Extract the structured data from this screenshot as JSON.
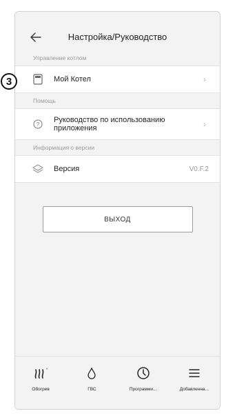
{
  "header": {
    "title": "Настройка/Руководство",
    "back_icon": "arrow-left-icon"
  },
  "badge": "3",
  "sections": {
    "boiler": {
      "label": "Управление котлом",
      "item_label": "Мой Котел",
      "icon": "boiler-icon"
    },
    "help": {
      "label": "Помощь",
      "item_label": "Руководство по использованию приложения",
      "icon": "help-circle-icon"
    },
    "version": {
      "label": "Информация о версии",
      "item_label": "Версия",
      "value": "V0.F.2",
      "icon": "layers-icon"
    }
  },
  "logout_label": "ВЫХОД",
  "tabs": [
    {
      "label": "Обогрев",
      "icon": "heating-icon"
    },
    {
      "label": "ГВС",
      "icon": "water-drop-icon"
    },
    {
      "label": "Программи...",
      "icon": "clock-icon"
    },
    {
      "label": "Добавленна...",
      "icon": "menu-icon"
    }
  ]
}
